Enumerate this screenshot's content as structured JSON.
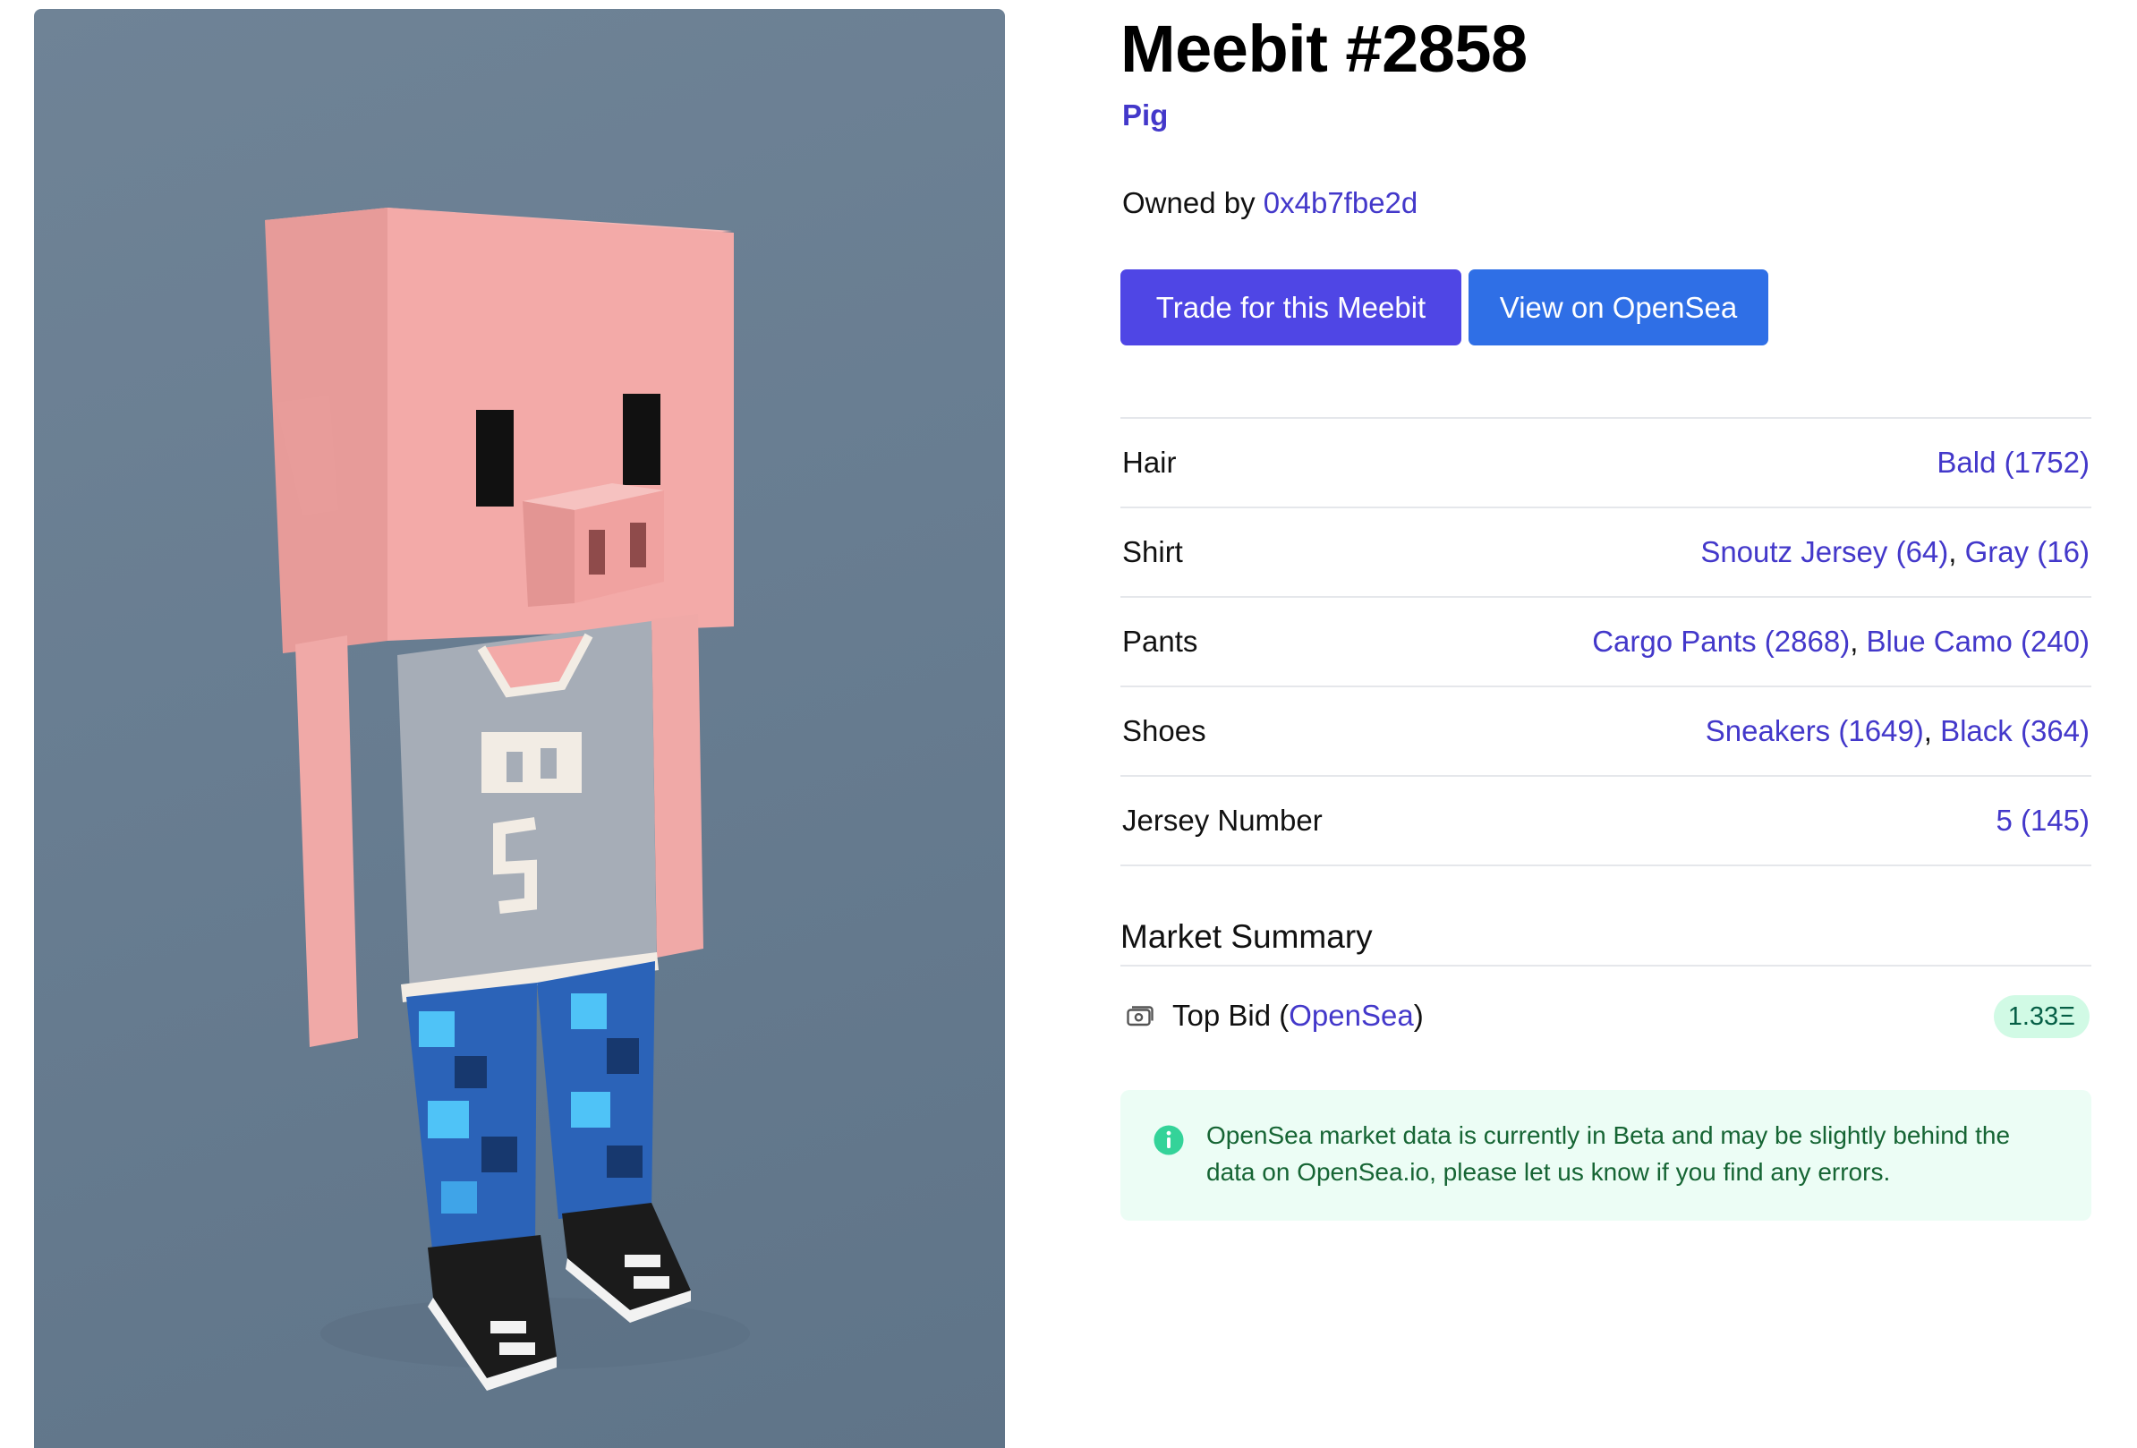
{
  "meebit": {
    "title": "Meebit #2858",
    "type": "Pig",
    "owner_prefix": "Owned by",
    "owner": "0x4b7fbe2d"
  },
  "actions": {
    "trade_label": "Trade for this Meebit",
    "opensea_label": "View on OpenSea"
  },
  "traits": [
    {
      "name": "Hair",
      "values": [
        "Bald (1752)"
      ]
    },
    {
      "name": "Shirt",
      "values": [
        "Snoutz Jersey (64)",
        "Gray (16)"
      ]
    },
    {
      "name": "Pants",
      "values": [
        "Cargo Pants (2868)",
        "Blue Camo (240)"
      ]
    },
    {
      "name": "Shoes",
      "values": [
        "Sneakers (1649)",
        "Black (364)"
      ]
    },
    {
      "name": "Jersey Number",
      "values": [
        "5 (145)"
      ]
    }
  ],
  "market": {
    "heading": "Market Summary",
    "top_bid_label": "Top Bid (",
    "top_bid_source": "OpenSea",
    "top_bid_suffix": ")",
    "top_bid_value": "1.33Ξ",
    "notice": "OpenSea market data is currently in Beta and may be slightly behind the data on OpenSea.io, please let us know if you find any errors."
  },
  "colors": {
    "accent": "#4338ca",
    "trade_button": "#4f46e5",
    "opensea_button": "#2f6fe6",
    "badge_bg": "#d1fae5",
    "notice_bg": "#ecfdf5"
  },
  "icons": {
    "bid": "money-icon",
    "notice": "info-circle-icon"
  }
}
